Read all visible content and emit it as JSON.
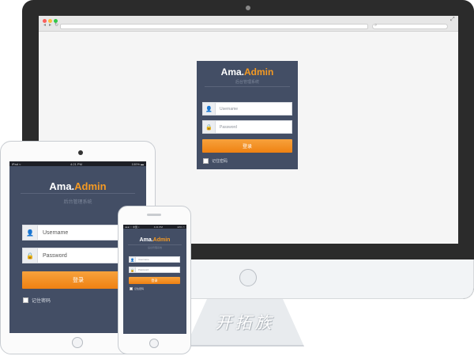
{
  "brand": {
    "name": "Ama.",
    "accent": "Admin",
    "accent_color": "#f59a23",
    "panel_color": "#434e65"
  },
  "subtitle": "后台管理系统",
  "login": {
    "username_placeholder": "Username",
    "password_placeholder": "Password",
    "submit_label": "登录",
    "remember_label": "记住密码"
  },
  "icons": {
    "user": "user-icon",
    "lock": "lock-icon"
  },
  "ipad_status": {
    "left": "iPad ≈",
    "time": "4:21 PM",
    "right": "100% ▬"
  },
  "iphone_status": {
    "left": "●●●○○ 中国 ≈",
    "time": "4:21 PM",
    "right": "22% ▭"
  },
  "stand_text": "开拓族"
}
